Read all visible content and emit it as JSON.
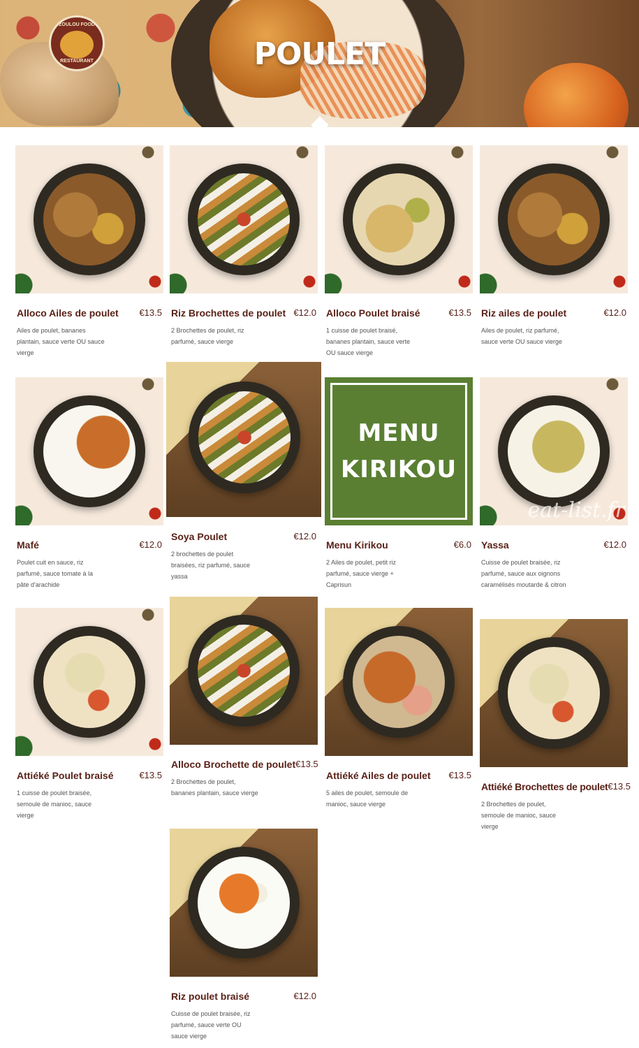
{
  "header": {
    "title": "POULET",
    "logo_top": "ZOULOU FOOD",
    "logo_bottom": "RESTAURANT"
  },
  "currency_color": "#5a2218",
  "watermark": "eat-list.fr",
  "kirikou_tile": {
    "line1": "MENU",
    "line2": "KIRIKOU"
  },
  "products": [
    {
      "name": "Alloco Ailes de poulet",
      "price": "€13.5",
      "desc": "Ailes de poulet, bananes plantain, sauce verte OU sauce vierge"
    },
    {
      "name": "Riz Brochettes de poulet",
      "price": "€12.0",
      "desc": "2 Brochettes de poulet, riz parfumé, sauce vierge"
    },
    {
      "name": "Alloco Poulet braisé",
      "price": "€13.5",
      "desc": "1 cuisse de poulet braisé, bananes plantain, sauce verte OU sauce vierge"
    },
    {
      "name": "Riz ailes de poulet",
      "price": "€12.0",
      "desc": "Ailes de poulet, riz parfumé, sauce verte OU sauce vierge"
    },
    {
      "name": "Mafé",
      "price": "€12.0",
      "desc": "Poulet cuit en sauce, riz parfumé, sauce tomate à la pâte d'arachide"
    },
    {
      "name": "Soya Poulet",
      "price": "€12.0",
      "desc": "2 brochettes de poulet braisées, riz parfumé, sauce yassa"
    },
    {
      "name": "Menu Kirikou",
      "price": "€6.0",
      "desc": "2 Ailes de poulet, petit riz parfumé, sauce vierge + Caprisun"
    },
    {
      "name": "Yassa",
      "price": "€12.0",
      "desc": "Cuisse de poulet braisée, riz parfumé, sauce aux oignons caramélisés moutarde & citron"
    },
    {
      "name": "Attiéké Poulet braisé",
      "price": "€13.5",
      "desc": "1 cuisse de poulet braisée, semoule de manioc, sauce vierge"
    },
    {
      "name": "Alloco Brochette de poulet",
      "price": "€13.5",
      "desc": "2 Brochettes de poulet, bananes plantain, sauce vierge"
    },
    {
      "name": "Attiéké Ailes de poulet",
      "price": "€13.5",
      "desc": "5 ailes de poulet, semoule de manioc, sauce vierge"
    },
    {
      "name": "Attiéké Brochettes de poulet",
      "price": "€13.5",
      "desc": "2 Brochettes de poulet, semoule de manioc, sauce vierge"
    },
    {
      "name": "Riz poulet braisé",
      "price": "€12.0",
      "desc": "Cuisse de poulet braisée, riz parfumé, sauce verte OU sauce vierge"
    }
  ]
}
